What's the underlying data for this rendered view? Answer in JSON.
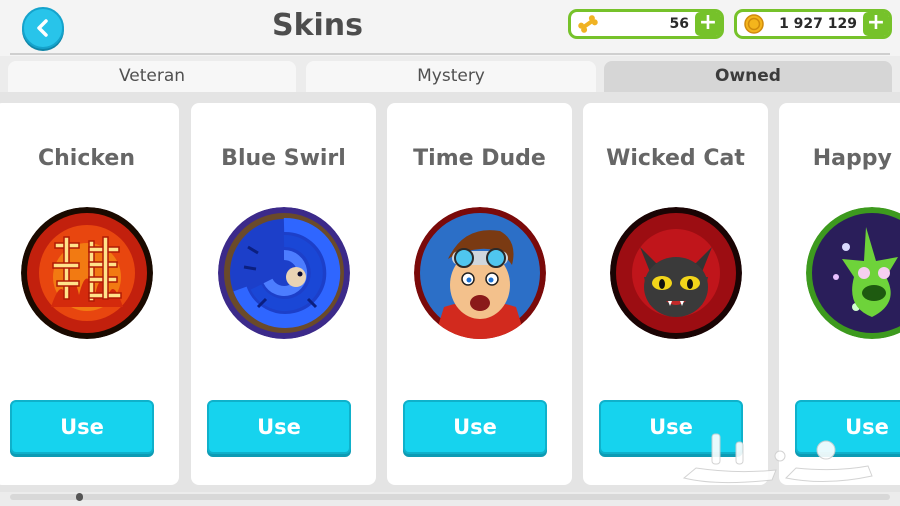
{
  "header": {
    "title": "Skins",
    "back_icon": "chevron-left-icon",
    "currencies": [
      {
        "icon": "bone-icon",
        "value": "56",
        "plus": "+"
      },
      {
        "icon": "coin-icon",
        "value": "1 927 129",
        "plus": "+"
      }
    ]
  },
  "tabs": [
    {
      "label": "Veteran",
      "active": false
    },
    {
      "label": "Mystery",
      "active": false
    },
    {
      "label": "Owned",
      "active": true
    }
  ],
  "skins": [
    {
      "name": "Chicken",
      "button": "Use"
    },
    {
      "name": "Blue Swirl",
      "button": "Use"
    },
    {
      "name": "Time Dude",
      "button": "Use"
    },
    {
      "name": "Wicked Cat",
      "button": "Use"
    },
    {
      "name": "Happy Se",
      "button": "Use"
    }
  ],
  "colors": {
    "accent": "#16d3ee",
    "currency_green": "#76c22a",
    "back_button": "#28c4ea"
  }
}
